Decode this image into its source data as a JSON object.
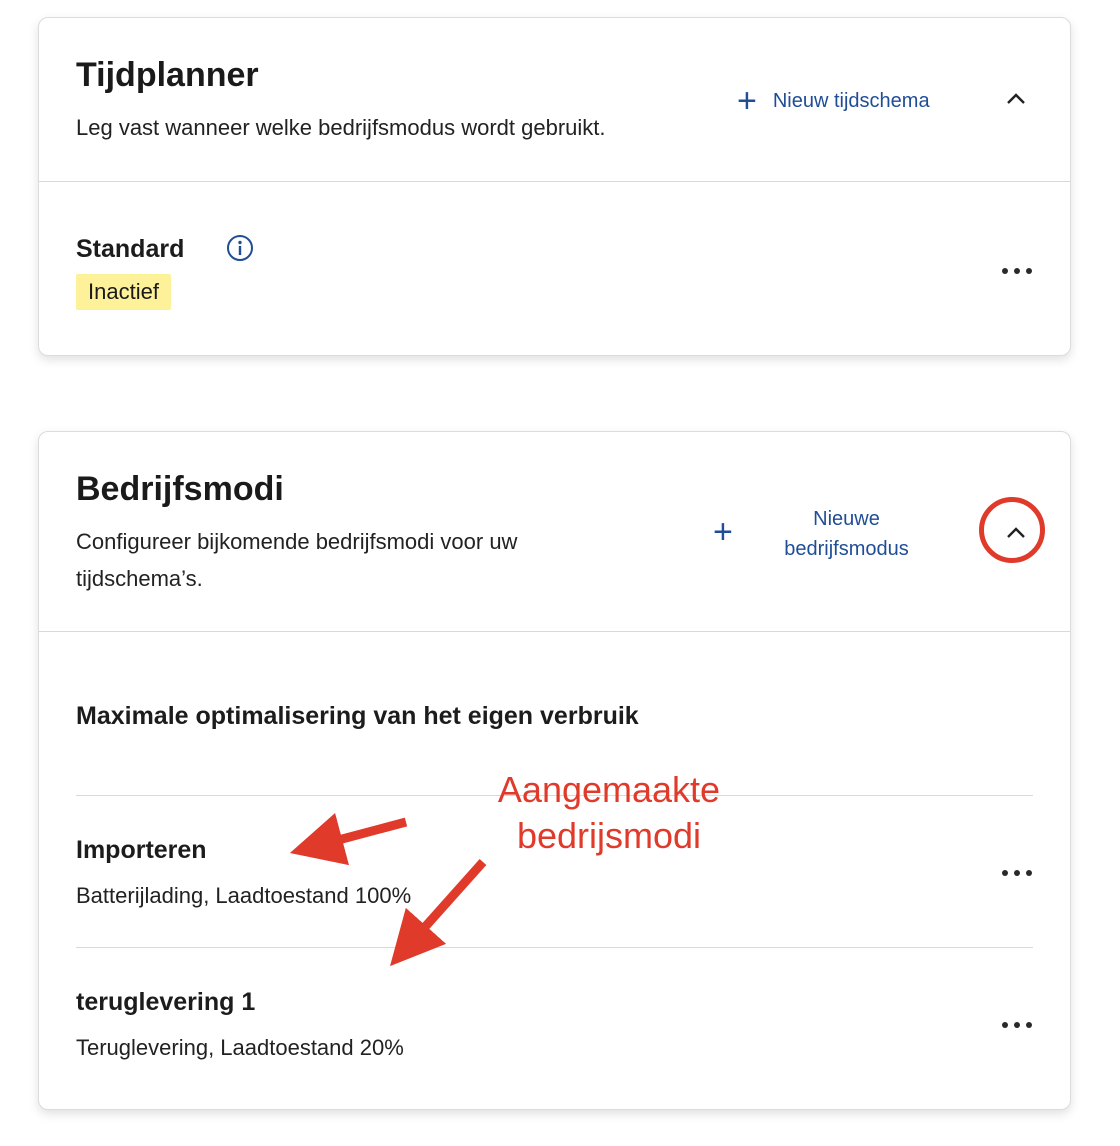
{
  "scheduler": {
    "title": "Tijdplanner",
    "description": "Leg vast wanneer welke bedrijfsmodus wordt gebruikt.",
    "add_label": "Nieuw tijdschema",
    "schedule": {
      "name": "Standard",
      "status": "Inactief"
    }
  },
  "modes": {
    "title": "Bedrijfsmodi",
    "description": "Configureer bijkomende bedrijfsmodi voor uw tijdschema’s.",
    "add_label_line1": "Nieuwe",
    "add_label_line2": "bedrijfsmodus",
    "section_title": "Maximale optimalisering van het eigen verbruik",
    "items": [
      {
        "name": "Importeren",
        "detail": "Batterijlading, Laadtoestand 100%"
      },
      {
        "name": "teruglevering 1",
        "detail": "Teruglevering, Laadtoestand 20%"
      }
    ]
  },
  "annotation": {
    "line1": "Aangemaakte",
    "line2": "bedrijsmodi",
    "color": "#e03a2b"
  },
  "colors": {
    "link": "#1f4e96",
    "badge_bg": "#fdf19a",
    "annotation": "#e03a2b"
  },
  "icons": [
    "plus-icon",
    "chevron-up-icon",
    "info-icon",
    "more-icon"
  ]
}
